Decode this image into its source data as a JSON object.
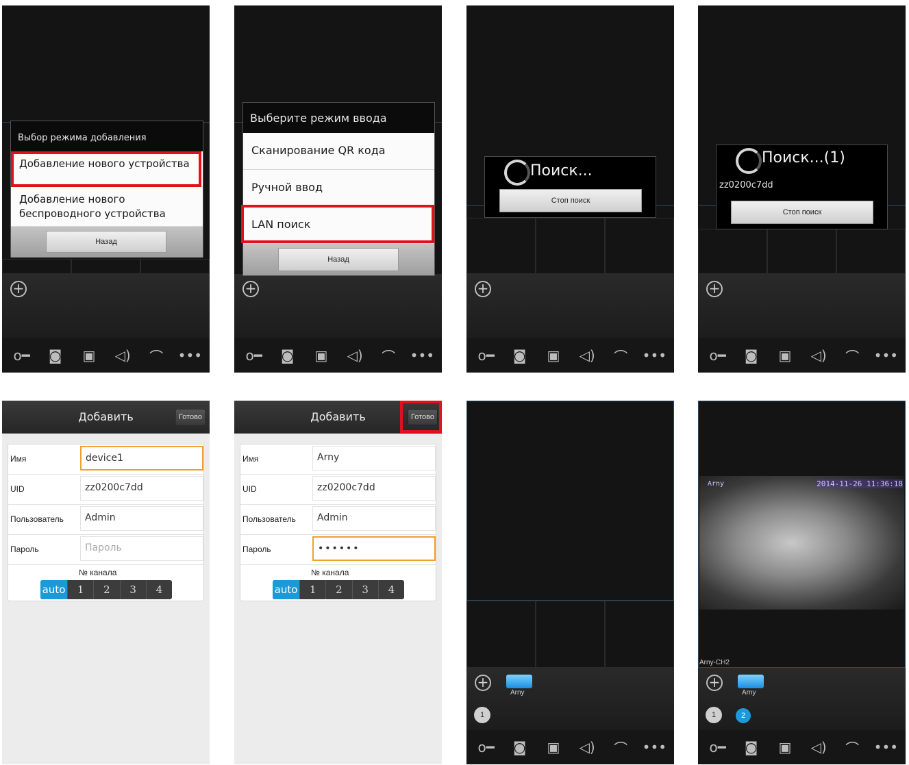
{
  "toolbar_icons": [
    "key-icon",
    "camera-icon",
    "video-record-icon",
    "speaker-icon",
    "phone-icon",
    "more-icon"
  ],
  "step1": {
    "title": "Выбор режима добавления",
    "option1": "Добавление нового устройства",
    "option2": "Добавление нового беспроводного устройства",
    "back": "Назад"
  },
  "step2": {
    "title": "Выберите режим ввода",
    "option1": "Сканирование QR кода",
    "option2": "Ручной ввод",
    "option3": "LAN поиск",
    "back": "Назад"
  },
  "step3": {
    "status": "Поиск...",
    "stop": "Стоп поиск"
  },
  "step4": {
    "status": "Поиск...(1)",
    "found_uid": "zz0200c7dd",
    "stop": "Стоп поиск"
  },
  "form1": {
    "title": "Добавить",
    "done": "Готово",
    "name_label": "Имя",
    "name_value": "device1",
    "uid_label": "UID",
    "uid_value": "zz0200c7dd",
    "user_label": "Пользователь",
    "user_value": "Admin",
    "pass_label": "Пароль",
    "pass_placeholder": "Пароль",
    "channel_label": "№ канала",
    "channels": [
      "auto",
      "1",
      "2",
      "3",
      "4"
    ]
  },
  "form2": {
    "title": "Добавить",
    "done": "Готово",
    "name_label": "Имя",
    "name_value": "Arny",
    "uid_label": "UID",
    "uid_value": "zz0200c7dd",
    "user_label": "Пользователь",
    "user_value": "Admin",
    "pass_label": "Пароль",
    "pass_value": "••••••",
    "channel_label": "№ канала",
    "channels": [
      "auto",
      "1",
      "2",
      "3",
      "4"
    ]
  },
  "view1": {
    "camera_name": "Arny",
    "channel": "1"
  },
  "view2": {
    "overlay_name": "Arny",
    "overlay_time": "2014-11-26 11:36:18",
    "tile_label": "Arny-CH2",
    "camera_name": "Arny",
    "channels": [
      "1",
      "2"
    ]
  },
  "colors": {
    "highlight": "#e0101c",
    "accent_blue": "#1a9ad8",
    "input_focus": "#f0a030"
  }
}
